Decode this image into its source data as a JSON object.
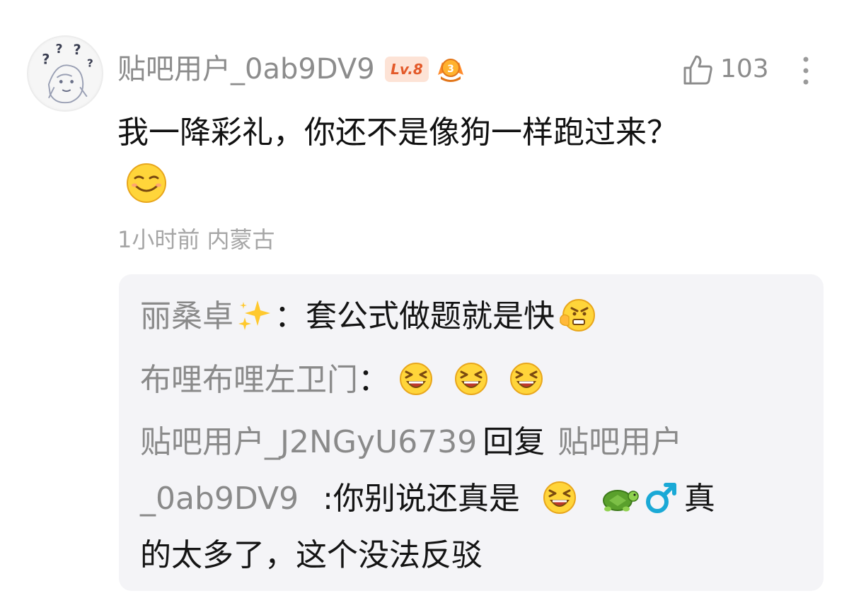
{
  "post": {
    "username": "贴吧用户_0ab9DV9",
    "level": "Lv.8",
    "medal_number": "3",
    "likes": "103",
    "comment": "我一降彩礼，你还不是像狗一样跑过来？",
    "time": "1小时前",
    "location": "内蒙古",
    "icons": [
      "avatar",
      "level-badge",
      "medal-icon",
      "thumbs-up-icon",
      "more-vertical-icon",
      "smile-emoji"
    ]
  },
  "replies": [
    {
      "name": "丽桑卓",
      "colon": "：",
      "text": "套公式做题就是快",
      "icons": [
        "sparkles-emoji",
        "grimace-emoji"
      ]
    },
    {
      "name": "布哩布哩左卫门",
      "colon": "：",
      "text": "",
      "icons": [
        "laughing-emoji",
        "laughing-emoji",
        "laughing-emoji"
      ]
    },
    {
      "name": "贴吧用户_J2NGyU6739",
      "reply_word": "回复",
      "target_line1": "贴吧用户",
      "target_line2": "_0ab9DV9",
      "colon": ":",
      "text_part1": "你别说还真是",
      "text_part2": "真",
      "text_line2": "的太多了，这个没法反驳",
      "icons": [
        "laughing-emoji",
        "turtle-emoji",
        "male-sign-emoji"
      ]
    }
  ],
  "colors": {
    "username_gray": "#8c8c8c",
    "meta_gray": "#a6a6a6",
    "reply_bg": "#f4f4f7",
    "level_badge_bg": "#fde3d6",
    "level_badge_text": "#e35a2a",
    "male_sign": "#1aa9d6"
  }
}
